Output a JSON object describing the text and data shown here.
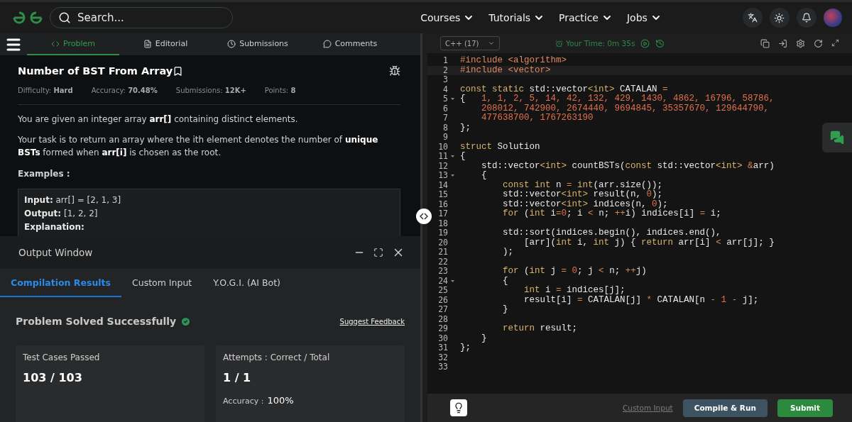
{
  "nav": {
    "search": {
      "placeholder": "Search..."
    },
    "menus": [
      {
        "label": "Courses"
      },
      {
        "label": "Tutorials"
      },
      {
        "label": "Practice"
      },
      {
        "label": "Jobs"
      }
    ]
  },
  "problem_tabs": [
    {
      "label": "Problem",
      "selected": true
    },
    {
      "label": "Editorial",
      "selected": false
    },
    {
      "label": "Submissions",
      "selected": false
    },
    {
      "label": "Comments",
      "selected": false
    }
  ],
  "problem": {
    "title": "Number of BST From Array",
    "meta": [
      "Difficulty: **Hard**",
      "Accuracy: **70.48%**",
      "Submissions: **12K+**",
      "Points: **8**"
    ],
    "paragraphs": [
      "You are given an integer array **arr[]** containing distinct elements.",
      "Your task is to return an array where the ith element denotes the number of **unique BSTs** formed when **arr[i]** is chosen as the root."
    ],
    "examples_heading": "Examples :",
    "example_lines": [
      "**Input:** arr[] = [2, 1, 3]",
      "**Output:** [1, 2, 2]",
      "**Explanation:**"
    ]
  },
  "output_window": {
    "title": "Output Window",
    "tabs": [
      {
        "label": "Compilation Results",
        "selected": true
      },
      {
        "label": "Custom Input",
        "selected": false
      },
      {
        "label": "Y.O.G.I. (AI Bot)",
        "selected": false
      }
    ],
    "status": "Problem Solved Successfully",
    "solved": true,
    "feedback_link": "Suggest Feedback",
    "cards": [
      {
        "label": "Test Cases Passed",
        "value": "103 / 103"
      },
      {
        "label": "Attempts : Correct / Total",
        "value": "1 / 1",
        "note_label": "Accuracy :",
        "note_value": "100%"
      }
    ]
  },
  "editor": {
    "language": "C++ (17)",
    "timer": "Your Time: 0m 35s",
    "lines": [
      {
        "number": "1",
        "tokens": [
          {
            "t": "#include <algorithm>",
            "kind": "preprocessor"
          }
        ]
      },
      {
        "number": "2",
        "current": true,
        "tokens": [
          {
            "t": "#include <vector>",
            "kind": "preprocessor"
          }
        ]
      },
      {
        "number": "3"
      },
      {
        "number": "4",
        "tokens": [
          {
            "t": "const static ",
            "kind": "keyword"
          },
          {
            "t": "std::vector",
            "kind": "plain"
          },
          {
            "t": "<int>",
            "kind": "keyword"
          },
          {
            "t": " CATALAN ",
            "kind": "plain"
          },
          {
            "t": "=",
            "kind": "operator"
          }
        ]
      },
      {
        "number": "5",
        "fold": true,
        "tokens": [
          {
            "t": "{   ",
            "kind": "plain"
          },
          {
            "t": "1, 1, 2, 5, 14, 42, 132, 429, 1430, 4862, 16796, 58786,",
            "kind": "number"
          }
        ]
      },
      {
        "number": "6",
        "tokens": [
          {
            "t": "    208012, 742900, 2674440, 9694845, 35357670, 129644790,",
            "kind": "number"
          }
        ]
      },
      {
        "number": "7",
        "tokens": [
          {
            "t": "    477638700, 1767263190",
            "kind": "number"
          }
        ]
      },
      {
        "number": "8",
        "tokens": [
          {
            "t": "};",
            "kind": "plain"
          }
        ]
      },
      {
        "number": "9"
      },
      {
        "number": "10",
        "tokens": [
          {
            "t": "struct ",
            "kind": "keyword"
          },
          {
            "t": "Solution",
            "kind": "plain"
          }
        ]
      },
      {
        "number": "11",
        "fold": true,
        "tokens": [
          {
            "t": "{",
            "kind": "plain"
          }
        ]
      },
      {
        "number": "12",
        "tokens": [
          {
            "t": "    std::vector",
            "kind": "plain"
          },
          {
            "t": "<int>",
            "kind": "keyword"
          },
          {
            "t": " countBSTs(",
            "kind": "plain"
          },
          {
            "t": "const ",
            "kind": "keyword"
          },
          {
            "t": "std::vector",
            "kind": "plain"
          },
          {
            "t": "<int> ",
            "kind": "keyword"
          },
          {
            "t": "&",
            "kind": "operator"
          },
          {
            "t": "arr)",
            "kind": "plain"
          }
        ]
      },
      {
        "number": "13",
        "fold": true,
        "tokens": [
          {
            "t": "    {",
            "kind": "plain"
          }
        ]
      },
      {
        "number": "14",
        "tokens": [
          {
            "t": "        const int ",
            "kind": "keyword"
          },
          {
            "t": "n ",
            "kind": "plain"
          },
          {
            "t": "= ",
            "kind": "operator"
          },
          {
            "t": "int",
            "kind": "keyword"
          },
          {
            "t": "(arr.size());",
            "kind": "plain"
          }
        ]
      },
      {
        "number": "15",
        "tokens": [
          {
            "t": "        std::vector",
            "kind": "plain"
          },
          {
            "t": "<int>",
            "kind": "keyword"
          },
          {
            "t": " result(n, ",
            "kind": "plain"
          },
          {
            "t": "0",
            "kind": "number"
          },
          {
            "t": ");",
            "kind": "plain"
          }
        ]
      },
      {
        "number": "16",
        "tokens": [
          {
            "t": "        std::vector",
            "kind": "plain"
          },
          {
            "t": "<int>",
            "kind": "keyword"
          },
          {
            "t": " indices(n, ",
            "kind": "plain"
          },
          {
            "t": "0",
            "kind": "number"
          },
          {
            "t": ");",
            "kind": "plain"
          }
        ]
      },
      {
        "number": "17",
        "tokens": [
          {
            "t": "        for ",
            "kind": "keyword"
          },
          {
            "t": "(",
            "kind": "plain"
          },
          {
            "t": "int ",
            "kind": "keyword"
          },
          {
            "t": "i",
            "kind": "plain"
          },
          {
            "t": "=",
            "kind": "operator"
          },
          {
            "t": "0",
            "kind": "number"
          },
          {
            "t": "; i ",
            "kind": "plain"
          },
          {
            "t": "<",
            "kind": "operator"
          },
          {
            "t": " n; ",
            "kind": "plain"
          },
          {
            "t": "++",
            "kind": "operator"
          },
          {
            "t": "i) indices[i] ",
            "kind": "plain"
          },
          {
            "t": "=",
            "kind": "operator"
          },
          {
            "t": " i;",
            "kind": "plain"
          }
        ]
      },
      {
        "number": "18"
      },
      {
        "number": "19",
        "tokens": [
          {
            "t": "        std::sort(indices.begin(), indices.end(),",
            "kind": "plain"
          }
        ]
      },
      {
        "number": "20",
        "tokens": [
          {
            "t": "            [arr](",
            "kind": "plain"
          },
          {
            "t": "int ",
            "kind": "keyword"
          },
          {
            "t": "i, ",
            "kind": "plain"
          },
          {
            "t": "int ",
            "kind": "keyword"
          },
          {
            "t": "j) { ",
            "kind": "plain"
          },
          {
            "t": "return ",
            "kind": "keyword"
          },
          {
            "t": "arr[i] ",
            "kind": "plain"
          },
          {
            "t": "<",
            "kind": "operator"
          },
          {
            "t": " arr[j]; }",
            "kind": "plain"
          }
        ]
      },
      {
        "number": "21",
        "tokens": [
          {
            "t": "        );",
            "kind": "plain"
          }
        ]
      },
      {
        "number": "22"
      },
      {
        "number": "23",
        "tokens": [
          {
            "t": "        for ",
            "kind": "keyword"
          },
          {
            "t": "(",
            "kind": "plain"
          },
          {
            "t": "int ",
            "kind": "keyword"
          },
          {
            "t": "j ",
            "kind": "plain"
          },
          {
            "t": "= ",
            "kind": "operator"
          },
          {
            "t": "0",
            "kind": "number"
          },
          {
            "t": "; j ",
            "kind": "plain"
          },
          {
            "t": "<",
            "kind": "operator"
          },
          {
            "t": " n; ",
            "kind": "plain"
          },
          {
            "t": "++",
            "kind": "operator"
          },
          {
            "t": "j)",
            "kind": "plain"
          }
        ]
      },
      {
        "number": "24",
        "fold": true,
        "tokens": [
          {
            "t": "        {",
            "kind": "plain"
          }
        ]
      },
      {
        "number": "25",
        "tokens": [
          {
            "t": "            int ",
            "kind": "keyword"
          },
          {
            "t": "i ",
            "kind": "plain"
          },
          {
            "t": "=",
            "kind": "operator"
          },
          {
            "t": " indices[j];",
            "kind": "plain"
          }
        ]
      },
      {
        "number": "26",
        "tokens": [
          {
            "t": "            result[i] ",
            "kind": "plain"
          },
          {
            "t": "=",
            "kind": "operator"
          },
          {
            "t": " CATALAN[j] ",
            "kind": "plain"
          },
          {
            "t": "*",
            "kind": "operator"
          },
          {
            "t": " CATALAN[n ",
            "kind": "plain"
          },
          {
            "t": "- ",
            "kind": "operator"
          },
          {
            "t": "1 ",
            "kind": "number"
          },
          {
            "t": "-",
            "kind": "operator"
          },
          {
            "t": " j];",
            "kind": "plain"
          }
        ]
      },
      {
        "number": "27",
        "tokens": [
          {
            "t": "        }",
            "kind": "plain"
          }
        ]
      },
      {
        "number": "28"
      },
      {
        "number": "29",
        "tokens": [
          {
            "t": "        return ",
            "kind": "keyword"
          },
          {
            "t": "result;",
            "kind": "plain"
          }
        ]
      },
      {
        "number": "30",
        "tokens": [
          {
            "t": "    }",
            "kind": "plain"
          }
        ]
      },
      {
        "number": "31",
        "tokens": [
          {
            "t": "};",
            "kind": "plain"
          }
        ]
      },
      {
        "number": "32"
      },
      {
        "number": "33"
      }
    ],
    "custom_input": "Custom Input",
    "compile_button": "Compile & Run",
    "submit_button": "Submit"
  }
}
